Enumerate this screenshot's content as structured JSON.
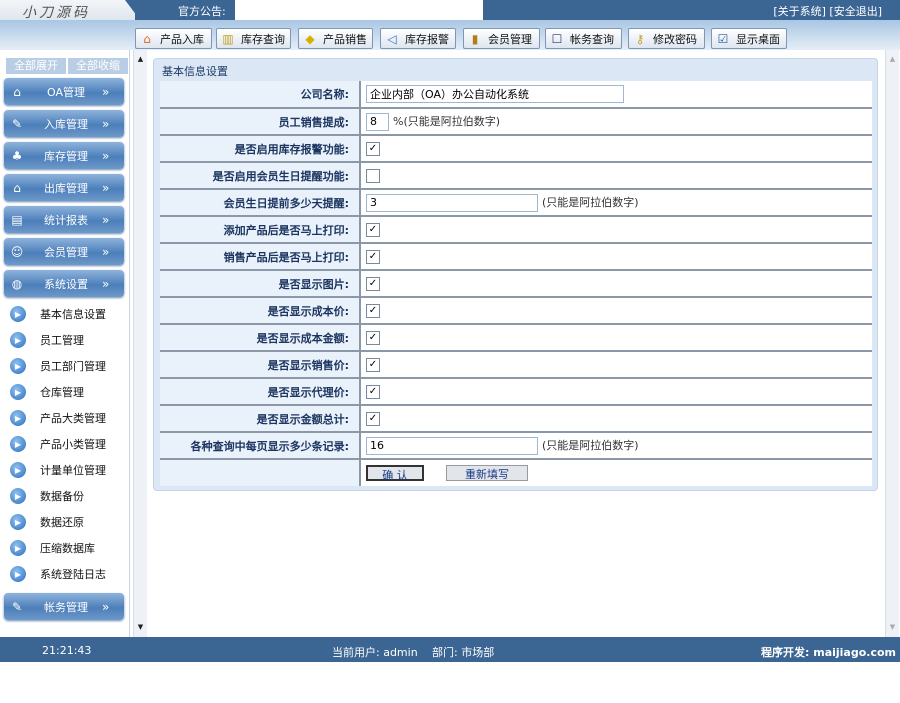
{
  "header": {
    "logo": "小刀源码",
    "notice_label": "官方公告:",
    "notice_value": "",
    "about": "[关于系统]",
    "logout": "[安全退出]"
  },
  "toolbar": [
    {
      "label": "产品入库",
      "icon": "house-icon"
    },
    {
      "label": "库存查询",
      "icon": "book-icon"
    },
    {
      "label": "产品销售",
      "icon": "tag-icon"
    },
    {
      "label": "库存报警",
      "icon": "speaker-icon"
    },
    {
      "label": "会员管理",
      "icon": "member-icon"
    },
    {
      "label": "帐务查询",
      "icon": "clipboard-icon"
    },
    {
      "label": "修改密码",
      "icon": "key-icon"
    },
    {
      "label": "显示桌面",
      "icon": "desktop-icon"
    }
  ],
  "sidebar": {
    "expand_all": "全部展开",
    "collapse_all": "全部收缩",
    "menus": [
      {
        "label": "OA管理"
      },
      {
        "label": "入库管理"
      },
      {
        "label": "库存管理"
      },
      {
        "label": "出库管理"
      },
      {
        "label": "统计报表"
      },
      {
        "label": "会员管理"
      },
      {
        "label": "系统设置"
      }
    ],
    "sub_items": [
      "基本信息设置",
      "员工管理",
      "员工部门管理",
      "仓库管理",
      "产品大类管理",
      "产品小类管理",
      "计量单位管理",
      "数据备份",
      "数据还原",
      "压缩数据库",
      "系统登陆日志"
    ],
    "last_menu": "帐务管理"
  },
  "form": {
    "title": "基本信息设置",
    "company_label": "公司名称:",
    "company_value": "企业内部（OA）办公自动化系统",
    "commission_label": "员工销售提成:",
    "commission_value": "8",
    "commission_hint": "%(只能是阿拉伯数字)",
    "stock_alarm_label": "是否启用库存报警功能:",
    "stock_alarm": true,
    "birthday_remind_label": "是否启用会员生日提醒功能:",
    "birthday_remind": false,
    "birthday_days_label": "会员生日提前多少天提醒:",
    "birthday_days_value": "3",
    "birthday_days_hint": "(只能是阿拉伯数字)",
    "checks": [
      {
        "label": "添加产品后是否马上打印:",
        "checked": true
      },
      {
        "label": "销售产品后是否马上打印:",
        "checked": true
      },
      {
        "label": "是否显示图片:",
        "checked": true
      },
      {
        "label": "是否显示成本价:",
        "checked": true
      },
      {
        "label": "是否显示成本金额:",
        "checked": true
      },
      {
        "label": "是否显示销售价:",
        "checked": true
      },
      {
        "label": "是否显示代理价:",
        "checked": true
      },
      {
        "label": "是否显示金额总计:",
        "checked": true
      }
    ],
    "page_size_label": "各种查询中每页显示多少条记录:",
    "page_size_value": "16",
    "page_size_hint": "(只能是阿拉伯数字)",
    "confirm": "确 认",
    "reset": "重新填写"
  },
  "status": {
    "time": "21:21:43",
    "user": "当前用户: admin",
    "dept": "部门: 市场部",
    "developer": "程序开发: maijiago.com"
  }
}
